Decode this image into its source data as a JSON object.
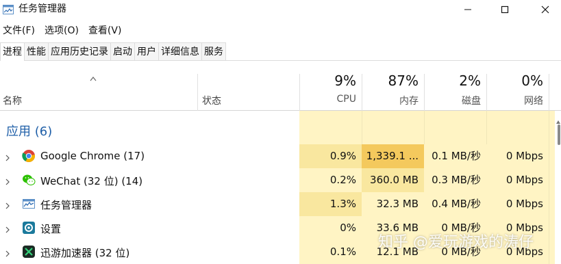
{
  "window": {
    "title": "任务管理器",
    "controls": {
      "minimize": "minimize-icon",
      "maximize": "maximize-icon",
      "close": "close-icon"
    }
  },
  "menu": [
    "文件(F)",
    "选项(O)",
    "查看(V)"
  ],
  "tabs": [
    {
      "label": "进程",
      "active": true
    },
    {
      "label": "性能",
      "active": false
    },
    {
      "label": "应用历史记录",
      "active": false
    },
    {
      "label": "启动",
      "active": false
    },
    {
      "label": "用户",
      "active": false
    },
    {
      "label": "详细信息",
      "active": false
    },
    {
      "label": "服务",
      "active": false
    }
  ],
  "columns": {
    "name": "名称",
    "status": "状态",
    "cpu": {
      "percent": "9%",
      "label": "CPU"
    },
    "memory": {
      "percent": "87%",
      "label": "内存"
    },
    "disk": {
      "percent": "2%",
      "label": "磁盘"
    },
    "network": {
      "percent": "0%",
      "label": "网络"
    }
  },
  "group": {
    "title": "应用 (6)"
  },
  "processes": [
    {
      "name": "Google Chrome (17)",
      "icon": "chrome-icon",
      "status": "",
      "cpu": "0.9%",
      "memory": "1,339.1 ...",
      "disk": "0.1 MB/秒",
      "network": "0 Mbps"
    },
    {
      "name": "WeChat (32 位) (14)",
      "icon": "wechat-icon",
      "status": "",
      "cpu": "0.2%",
      "memory": "360.0 MB",
      "disk": "0.3 MB/秒",
      "network": "0 Mbps"
    },
    {
      "name": "任务管理器",
      "icon": "task-manager-icon",
      "status": "",
      "cpu": "1.3%",
      "memory": "32.3 MB",
      "disk": "0.4 MB/秒",
      "network": "0 Mbps"
    },
    {
      "name": "设置",
      "icon": "settings-icon",
      "status": "",
      "cpu": "0%",
      "memory": "33.6 MB",
      "disk": "0 MB/秒",
      "network": "0 Mbps"
    },
    {
      "name": "迅游加速器 (32 位)",
      "icon": "xunyou-icon",
      "status": "",
      "cpu": "0.1%",
      "memory": "12.1 MB",
      "disk": "0 MB/秒",
      "network": "0 Mbps"
    }
  ],
  "colors": {
    "usage_low": "#fff4c4",
    "usage_mid": "#f9e79f",
    "usage_high": "#f4c95d",
    "group_title": "#1f5fa8"
  },
  "watermark": "知乎 @爱玩游戏的涛仔"
}
